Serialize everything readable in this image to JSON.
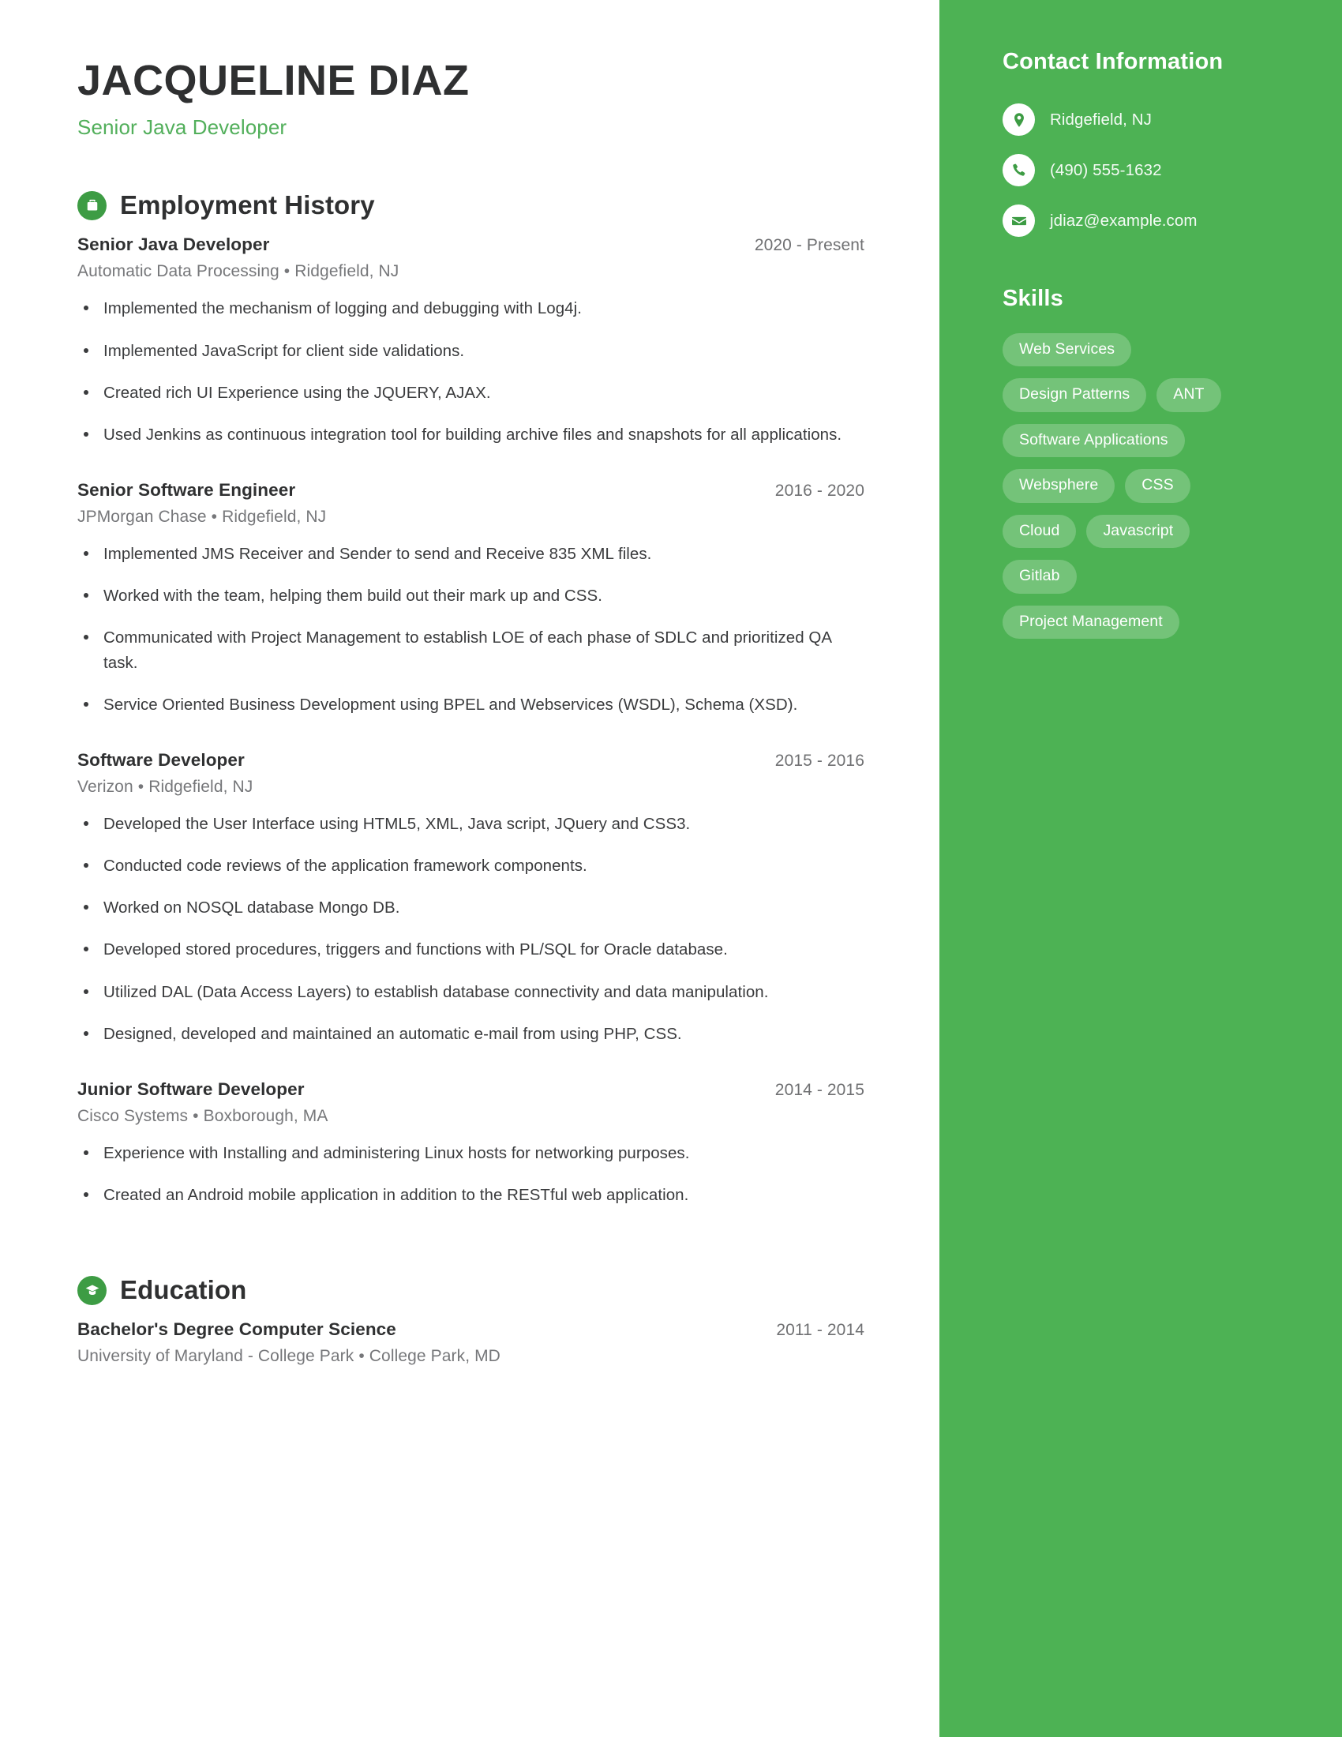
{
  "header": {
    "name": "JACQUELINE DIAZ",
    "job_title": "Senior Java Developer"
  },
  "sections": {
    "employment": {
      "heading": "Employment History",
      "icon": "briefcase-icon"
    },
    "education": {
      "heading": "Education",
      "icon": "graduation-cap-icon"
    }
  },
  "employment_entries": [
    {
      "title": "Senior Java Developer",
      "date": "2020 - Present",
      "company": "Automatic Data Processing",
      "location": "Ridgefield, NJ",
      "bullets": [
        "Implemented the mechanism of logging and debugging with Log4j.",
        "Implemented JavaScript for client side validations.",
        "Created rich UI Experience using the JQUERY, AJAX.",
        "Used Jenkins as continuous integration tool for building archive files and snapshots for all applications."
      ]
    },
    {
      "title": "Senior Software Engineer",
      "date": "2016 - 2020",
      "company": "JPMorgan Chase",
      "location": "Ridgefield, NJ",
      "bullets": [
        "Implemented JMS Receiver and Sender to send and Receive 835 XML files.",
        "Worked with the team, helping them build out their mark up and CSS.",
        "Communicated with Project Management to establish LOE of each phase of SDLC and prioritized QA task.",
        "Service Oriented Business Development using BPEL and Webservices (WSDL), Schema (XSD)."
      ]
    },
    {
      "title": "Software Developer",
      "date": "2015 - 2016",
      "company": "Verizon",
      "location": "Ridgefield, NJ",
      "bullets": [
        "Developed the User Interface using HTML5, XML, Java script, JQuery and CSS3.",
        "Conducted code reviews of the application framework components.",
        "Worked on NOSQL database Mongo DB.",
        "Developed stored procedures, triggers and functions with PL/SQL for Oracle database.",
        "Utilized DAL (Data Access Layers) to establish database connectivity and data manipulation.",
        "Designed, developed and maintained an automatic e-mail from using PHP, CSS."
      ]
    },
    {
      "title": "Junior Software Developer",
      "date": "2014 - 2015",
      "company": "Cisco Systems",
      "location": "Boxborough, MA",
      "bullets": [
        "Experience with Installing and administering Linux hosts for networking purposes.",
        "Created an Android mobile application in addition to the RESTful web application."
      ]
    }
  ],
  "education_entries": [
    {
      "title": "Bachelor's Degree Computer Science",
      "date": "2011 - 2014",
      "school": "University of Maryland - College Park",
      "location": "College Park, MD"
    }
  ],
  "sidebar": {
    "contact_heading": "Contact Information",
    "contacts": [
      {
        "icon": "location-pin-icon",
        "text": "Ridgefield, NJ"
      },
      {
        "icon": "phone-icon",
        "text": "(490) 555-1632"
      },
      {
        "icon": "envelope-icon",
        "text": "jdiaz@example.com"
      }
    ],
    "skills_heading": "Skills",
    "skills": [
      "Web Services",
      "Design Patterns",
      "ANT",
      "Software Applications",
      "Websphere",
      "CSS",
      "Cloud",
      "Javascript",
      "Gitlab",
      "Project Management"
    ]
  },
  "separator": "•",
  "colors": {
    "sidebar_green": "#4db254",
    "accent_green": "#52af5b",
    "icon_green": "#3d9c44",
    "heading_dark": "#2f3031",
    "body_gray": "#3a3b3d",
    "muted_gray": "#76777a"
  }
}
